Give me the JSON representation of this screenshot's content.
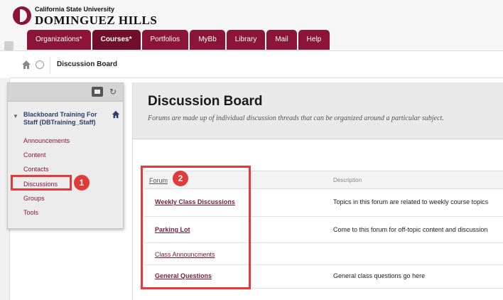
{
  "header": {
    "logo_line1": "California State University",
    "logo_line2": "DOMINGUEZ HILLS",
    "tabs": [
      {
        "label": "Organizations*",
        "active": false
      },
      {
        "label": "Courses*",
        "active": true
      },
      {
        "label": "Portfolios",
        "active": false
      },
      {
        "label": "MyBb",
        "active": false
      },
      {
        "label": "Library",
        "active": false
      },
      {
        "label": "Mail",
        "active": false
      },
      {
        "label": "Help",
        "active": false
      }
    ],
    "brand_color": "#8a1538"
  },
  "breadcrumb": {
    "current": "Discussion Board"
  },
  "course_menu": {
    "course_title": "Blackboard Training For Staff (DBTraining_Staff)",
    "items": [
      {
        "label": "Announcements"
      },
      {
        "label": "Content"
      },
      {
        "label": "Contacts"
      },
      {
        "label": "Discussions"
      },
      {
        "label": "Groups"
      },
      {
        "label": "Tools"
      }
    ]
  },
  "callouts": {
    "one": "1",
    "two": "2",
    "color": "#e03a3a"
  },
  "page": {
    "title": "Discussion Board",
    "subtitle": "Forums are made up of individual discussion threads that can be organized around a particular subject."
  },
  "table": {
    "columns": {
      "forum": "Forum",
      "description": "Description"
    },
    "rows": [
      {
        "forum": "Weekly Class Discussions",
        "description": "Topics in this forum are related to weekly course topics"
      },
      {
        "forum": "Parking Lot",
        "description": "Come to this forum for off-topic content and discussion"
      },
      {
        "forum": "Class Announcments",
        "description": ""
      },
      {
        "forum": "General Questions",
        "description": "General class questions go here"
      }
    ]
  }
}
